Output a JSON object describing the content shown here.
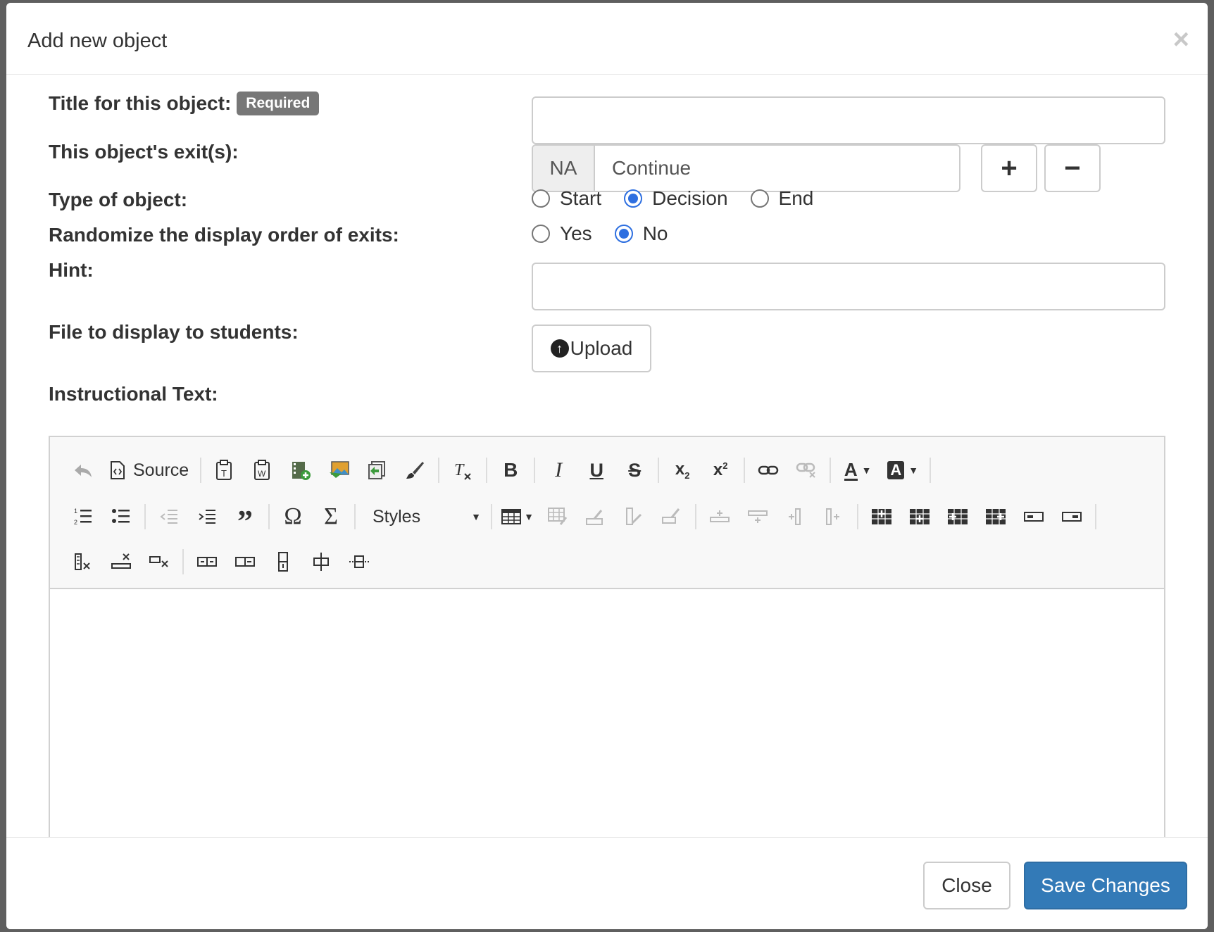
{
  "modal": {
    "title": "Add new object",
    "close_symbol": "×"
  },
  "form": {
    "title_label": "Title for this object:",
    "required_badge": "Required",
    "title_value": "",
    "exits_label": "This object's exit(s):",
    "exit_prefix": "NA",
    "exit_value": "Continue",
    "add_exit_symbol": "+",
    "remove_exit_symbol": "−",
    "type_label": "Type of object:",
    "type_options": [
      "Start",
      "Decision",
      "End"
    ],
    "type_selected": "Decision",
    "randomize_label": "Randomize the display order of exits:",
    "randomize_options": [
      "Yes",
      "No"
    ],
    "randomize_selected": "No",
    "hint_label": "Hint:",
    "hint_value": "",
    "file_label": "File to display to students:",
    "upload_label": "Upload",
    "instructional_label": "Instructional Text:"
  },
  "editor": {
    "source_label": "Source",
    "styles_label": "Styles",
    "toolbar_icons": [
      "undo-icon",
      "source-icon",
      "paste-text-icon",
      "paste-word-icon",
      "video-icon",
      "image-icon",
      "template-icon",
      "format-painter-icon",
      "remove-format-icon",
      "bold-icon",
      "italic-icon",
      "underline-icon",
      "strikethrough-icon",
      "subscript-icon",
      "superscript-icon",
      "link-icon",
      "unlink-icon",
      "text-color-icon",
      "background-color-icon",
      "numbered-list-icon",
      "bulleted-list-icon",
      "outdent-icon",
      "indent-icon",
      "blockquote-icon",
      "special-char-icon",
      "math-icon",
      "table-icon"
    ]
  },
  "footer": {
    "close_label": "Close",
    "save_label": "Save Changes"
  }
}
